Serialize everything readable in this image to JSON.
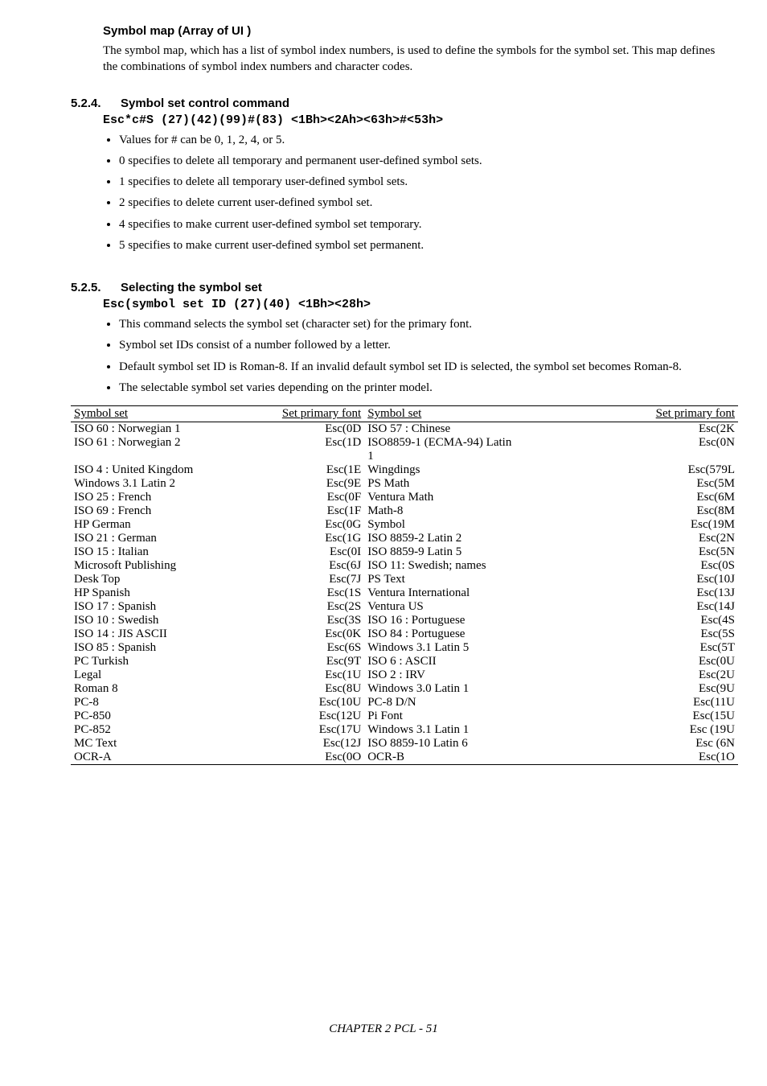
{
  "symbolMap": {
    "heading": "Symbol map (Array of UI )",
    "text": "The symbol map, which has a list of symbol index numbers, is used to define the symbols for the symbol set. This map defines the combinations of symbol index numbers and character codes."
  },
  "section524": {
    "num": "5.2.4.",
    "title": "Symbol set control command",
    "cmd": "Esc*c#S  (27)(42)(99)#(83)      <1Bh><2Ah><63h>#<53h>",
    "bullets": [
      "Values for # can be 0, 1, 2, 4, or 5.",
      "0 specifies to delete all temporary and permanent user-defined symbol sets.",
      "1 specifies to delete all temporary user-defined symbol sets.",
      "2 specifies to delete current user-defined symbol set.",
      "4 specifies to make current user-defined symbol set temporary.",
      "5 specifies to make current user-defined symbol set permanent."
    ]
  },
  "section525": {
    "num": "5.2.5.",
    "title": "Selecting the symbol set",
    "cmd": "Esc(symbol set ID   (27)(40)    <1Bh><28h>",
    "bullets": [
      "This command selects the symbol set (character set) for the primary font.",
      "Symbol set IDs consist of a number followed by a letter.",
      "Default symbol set ID is Roman-8.  If an invalid default symbol set ID is selected, the symbol set becomes Roman-8.",
      "The selectable symbol set varies depending on the printer model."
    ]
  },
  "table": {
    "headers": [
      "Symbol set",
      "Set primary font",
      "Symbol set",
      "Set primary font"
    ],
    "rows": [
      [
        "ISO 60 : Norwegian 1",
        "Esc(0D",
        "ISO 57 : Chinese",
        "Esc(2K"
      ],
      [
        "ISO 61 : Norwegian 2",
        "Esc(1D",
        "ISO8859-1 (ECMA-94) Latin",
        "Esc(0N"
      ],
      [
        "",
        "",
        "1",
        ""
      ],
      [
        "ISO 4  : United Kingdom",
        "Esc(1E",
        "Wingdings",
        "Esc(579L"
      ],
      [
        "Windows 3.1 Latin 2",
        "Esc(9E",
        "PS Math",
        "Esc(5M"
      ],
      [
        "ISO 25 : French",
        "Esc(0F",
        "Ventura Math",
        "Esc(6M"
      ],
      [
        "ISO 69 : French",
        "Esc(1F",
        "Math-8",
        "Esc(8M"
      ],
      [
        "HP German",
        "Esc(0G",
        "Symbol",
        "Esc(19M"
      ],
      [
        "ISO 21 : German",
        "Esc(1G",
        "ISO 8859-2 Latin 2",
        "Esc(2N"
      ],
      [
        "ISO 15 : Italian",
        "Esc(0I",
        "ISO 8859-9 Latin 5",
        "Esc(5N"
      ],
      [
        "Microsoft Publishing",
        "Esc(6J",
        "ISO 11: Swedish; names",
        "Esc(0S"
      ],
      [
        "Desk Top",
        "Esc(7J",
        "PS Text",
        "Esc(10J"
      ],
      [
        "HP Spanish",
        "Esc(1S",
        "Ventura International",
        "Esc(13J"
      ],
      [
        "ISO 17 : Spanish",
        "Esc(2S",
        "Ventura US",
        "Esc(14J"
      ],
      [
        "ISO 10 : Swedish",
        "Esc(3S",
        "ISO 16 : Portuguese",
        "Esc(4S"
      ],
      [
        "ISO 14 : JIS ASCII",
        "Esc(0K",
        "ISO 84 : Portuguese",
        "Esc(5S"
      ],
      [
        "ISO 85 : Spanish",
        "Esc(6S",
        "Windows 3.1 Latin 5",
        "Esc(5T"
      ],
      [
        "PC Turkish",
        "Esc(9T",
        "ISO 6 : ASCII",
        "Esc(0U"
      ],
      [
        "Legal",
        "Esc(1U",
        "ISO 2 : IRV",
        "Esc(2U"
      ],
      [
        "Roman 8",
        "Esc(8U",
        "Windows 3.0 Latin 1",
        "Esc(9U"
      ],
      [
        "PC-8",
        "Esc(10U",
        "PC-8 D/N",
        "Esc(11U"
      ],
      [
        "PC-850",
        "Esc(12U",
        "Pi Font",
        "Esc(15U"
      ],
      [
        "PC-852",
        "Esc(17U",
        "Windows 3.1 Latin 1",
        "Esc (19U"
      ],
      [
        "MC Text",
        "Esc(12J",
        "ISO 8859-10 Latin 6",
        "Esc (6N"
      ],
      [
        "OCR-A",
        "Esc(0O",
        "OCR-B",
        "Esc(1O"
      ]
    ]
  },
  "footer": "CHAPTER 2 PCL - 51"
}
